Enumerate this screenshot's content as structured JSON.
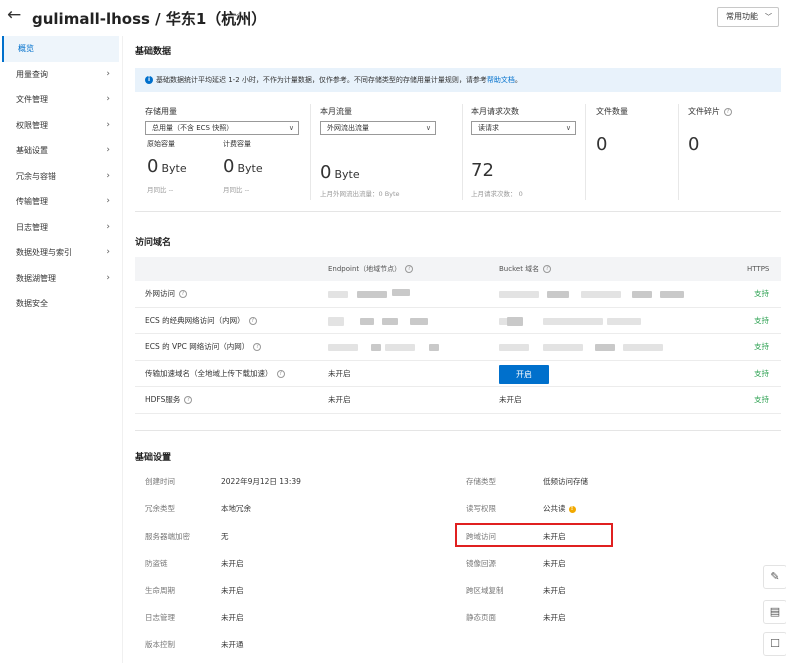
{
  "header": {
    "back_icon": "arrow-left-icon",
    "title": "gulimall-lhoss / 华东1（杭州）",
    "func_button": "常用功能"
  },
  "sidebar": {
    "items": [
      {
        "label": "概览",
        "active": true,
        "arrow": false
      },
      {
        "label": "用量查询",
        "arrow": true
      },
      {
        "label": "文件管理",
        "arrow": true
      },
      {
        "label": "权限管理",
        "arrow": true
      },
      {
        "label": "基础设置",
        "arrow": true
      },
      {
        "label": "冗余与容错",
        "arrow": true
      },
      {
        "label": "传输管理",
        "arrow": true
      },
      {
        "label": "日志管理",
        "arrow": true
      },
      {
        "label": "数据处理与索引",
        "arrow": true
      },
      {
        "label": "数据湖管理",
        "arrow": true
      },
      {
        "label": "数据安全",
        "arrow": false
      }
    ]
  },
  "basic_data": {
    "title": "基础数据",
    "notice": "基础数据统计平均延迟 1-2 小时，不作为计量数据，仅作参考。不同存储类型的存储用量计量规则，请参考",
    "notice_link": "帮助文档",
    "notice_end": "。",
    "storage": {
      "label": "存储用量",
      "select": "总用量（不含 ECS 快照）",
      "raw_label": "原始容量",
      "raw_value": "0",
      "raw_unit": "Byte",
      "raw_foot": "月同比 --",
      "billed_label": "计费容量",
      "billed_value": "0",
      "billed_unit": "Byte",
      "billed_foot": "月同比 --"
    },
    "traffic": {
      "label": "本月流量",
      "select": "外网流出流量",
      "value": "0",
      "unit": "Byte",
      "foot": "上月外网流出流量：0 Byte"
    },
    "requests": {
      "label": "本月请求次数",
      "select": "读请求",
      "value": "72",
      "foot": "上月请求次数： 0"
    },
    "file_count": {
      "label": "文件数量",
      "value": "0"
    },
    "fragments": {
      "label": "文件碎片",
      "value": "0"
    }
  },
  "access_domain": {
    "title": "访问域名",
    "headers": {
      "endpoint": "Endpoint（地域节点）",
      "bucket": "Bucket 域名",
      "https": "HTTPS"
    },
    "rows": [
      {
        "name": "外网访问",
        "https": "支持"
      },
      {
        "name": "ECS 的经典网络访问（内网）",
        "https": "支持"
      },
      {
        "name": "ECS 的 VPC 网络访问（内网）",
        "https": "支持"
      },
      {
        "name": "传输加速域名（全地域上传下载加速）",
        "endpoint": "未开启",
        "button": "开启",
        "https": "支持"
      },
      {
        "name": "HDFS服务",
        "endpoint": "未开启",
        "bucket": "未开启",
        "https": "支持"
      }
    ]
  },
  "basic_settings": {
    "title": "基础设置",
    "left": [
      {
        "key": "创建时间",
        "value": "2022年9月12日 13:39"
      },
      {
        "key": "冗余类型",
        "value": "本地冗余"
      },
      {
        "key": "服务器端加密",
        "value": "无"
      },
      {
        "key": "防盗链",
        "value": "未开启"
      },
      {
        "key": "生命周期",
        "value": "未开启"
      },
      {
        "key": "日志管理",
        "value": "未开启"
      },
      {
        "key": "版本控制",
        "value": "未开通"
      }
    ],
    "right": [
      {
        "key": "存储类型",
        "value": "低频访问存储"
      },
      {
        "key": "读写权限",
        "value": "公共读"
      },
      {
        "key": "跨域访问",
        "value": "未开启"
      },
      {
        "key": "镜像回源",
        "value": "未开启"
      },
      {
        "key": "跨区域复制",
        "value": "未开启"
      },
      {
        "key": "静态页面",
        "value": "未开启"
      }
    ]
  },
  "float_icons": [
    "edit-icon",
    "book-icon",
    "chat-icon"
  ]
}
